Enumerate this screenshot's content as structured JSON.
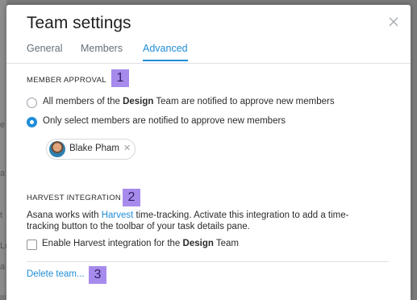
{
  "dialog": {
    "title": "Team settings",
    "close_icon": "close-icon"
  },
  "tabs": [
    {
      "label": "General",
      "active": false
    },
    {
      "label": "Members",
      "active": false
    },
    {
      "label": "Advanced",
      "active": true
    }
  ],
  "member_approval": {
    "heading": "MEMBER APPROVAL",
    "callout": "1",
    "option_all": {
      "prefix": "All members of the ",
      "team": "Design",
      "suffix": " Team are notified to approve new members",
      "selected": false
    },
    "option_select": {
      "label": "Only select members are notified to approve new members",
      "selected": true
    },
    "approver": {
      "name": "Blake Pham",
      "remove_icon": "close-icon"
    }
  },
  "harvest": {
    "heading": "HARVEST INTEGRATION",
    "callout": "2",
    "desc_prefix": "Asana works with ",
    "desc_link": "Harvest",
    "desc_suffix": " time-tracking. Activate this integration to add a time-tracking button to the toolbar of your task details pane.",
    "checkbox": {
      "prefix": "Enable Harvest integration for the ",
      "team": "Design",
      "suffix": " Team",
      "checked": false
    }
  },
  "footer": {
    "delete_label": "Delete team...",
    "callout": "3"
  },
  "background_fragments": [
    "e",
    "a",
    "t",
    "Lu",
    "a"
  ],
  "colors": {
    "accent": "#1f8dd6",
    "callout": "#a78bec",
    "backdrop": "#7a7a7a"
  }
}
